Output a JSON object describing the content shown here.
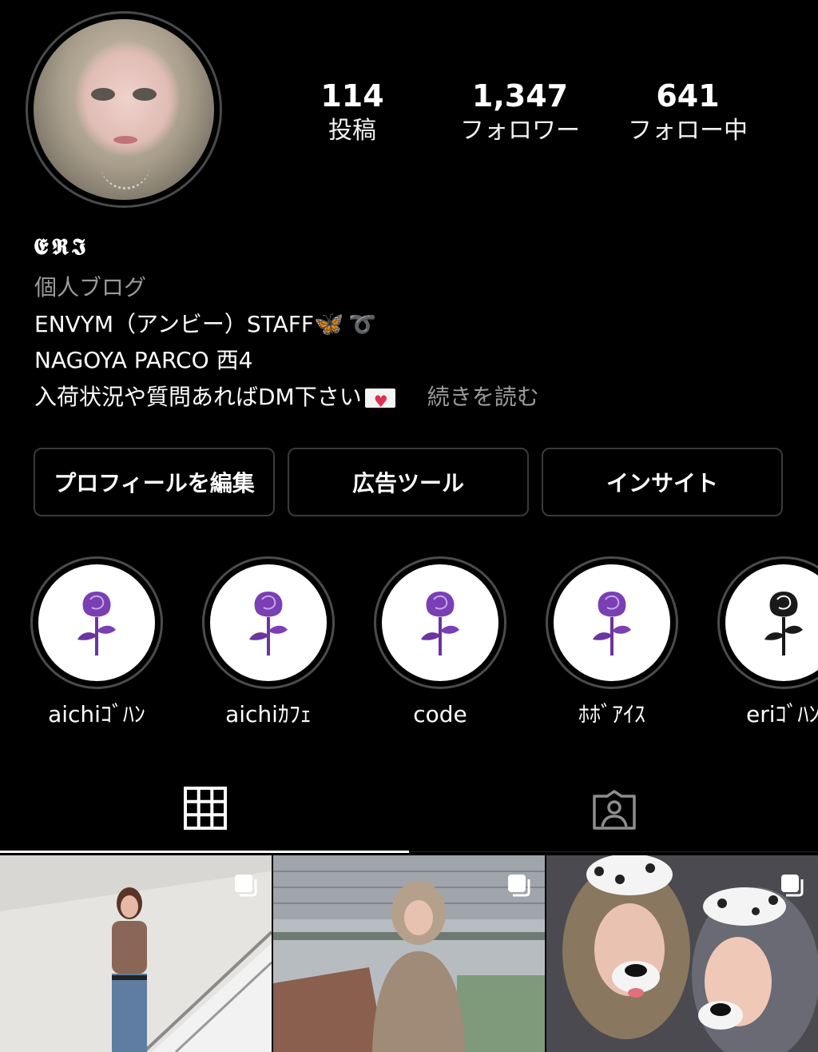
{
  "profile": {
    "display_name": "𝕰𝕽𝕴",
    "category": "個人ブログ",
    "bio_line1": "ENVYM（アンビー）STAFF",
    "bio_line2": "NAGOYA PARCO  西4",
    "bio_line3": "入荷状況や質問あればDM下さい",
    "more_link": "続きを読む"
  },
  "stats": [
    {
      "value": "114",
      "label": "投稿"
    },
    {
      "value": "1,347",
      "label": "フォロワー"
    },
    {
      "value": "641",
      "label": "フォロー中"
    }
  ],
  "buttons": {
    "edit_profile": "プロフィールを編集",
    "ad_tools": "広告ツール",
    "insights": "インサイト"
  },
  "highlights": [
    {
      "label": "aichiｺﾞﾊﾝ",
      "icon": "purple-rose-icon"
    },
    {
      "label": "aichiｶﾌｪ",
      "icon": "purple-rose-icon"
    },
    {
      "label": "code",
      "icon": "purple-rose-icon"
    },
    {
      "label": "ﾎﾎﾞｱｲｽ",
      "icon": "purple-rose-icon"
    },
    {
      "label": "eriｺﾞﾊﾝ",
      "icon": "black-rose-icon"
    }
  ],
  "tabs": [
    {
      "icon": "grid-icon",
      "active": true
    },
    {
      "icon": "tagged-person-icon",
      "active": false
    }
  ],
  "posts": [
    {
      "subject": "woman in brown top on stairs",
      "multi": true
    },
    {
      "subject": "woman in beige hoodie on terrace",
      "multi": true
    },
    {
      "subject": "two women with dalmatian dog filter",
      "multi": true
    }
  ],
  "colors": {
    "background": "#000000",
    "secondary_text": "#9a9a9a",
    "border": "#3a3a3a",
    "rose_purple": "#7a3fb3"
  }
}
